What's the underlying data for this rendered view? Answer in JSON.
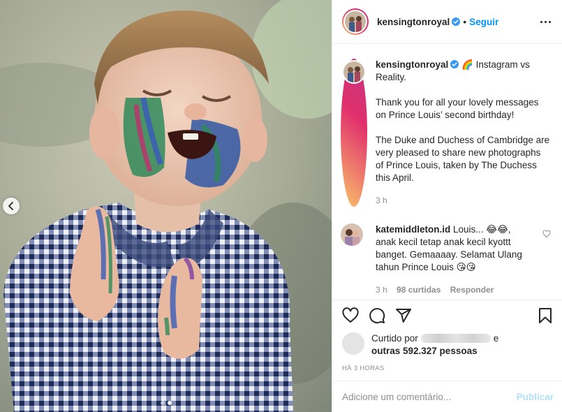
{
  "post": {
    "photo_alt": "Prince Louis with paint on his face and hands",
    "nav_prev_icon": "chevron-left-icon",
    "carousel_count": 2,
    "carousel_active": 1
  },
  "header": {
    "username": "kensingtonroyal",
    "verified_icon": "verified-badge-icon",
    "separator": "•",
    "follow_label": "Seguir",
    "more_icon": "more-options-icon"
  },
  "caption": {
    "username": "kensingtonroyal",
    "emoji": "🌈",
    "lines": [
      "Instagram vs Reality.",
      "Thank you for all your lovely messages on Prince Louis’ second birthday!",
      "The Duke and Duchess of Cambridge are very pleased to share new photographs of Prince Louis, taken by The Duchess this April."
    ],
    "time": "3 h"
  },
  "comments": [
    {
      "username": "katemiddleton.id",
      "text": "Louis... 😂😂, anak kecil tetap anak kecil kyottt banget. Gemaaaay. Selamat Ulang tahun Prince Louis 😘😘",
      "time": "3 h",
      "likes": "98 curtidas",
      "reply_label": "Responder"
    }
  ],
  "actions": {
    "like_icon": "heart-icon",
    "comment_icon": "comment-icon",
    "share_icon": "share-icon",
    "save_icon": "bookmark-icon"
  },
  "likes": {
    "prefix": "Curtido por",
    "suffix": "e",
    "others": "outras 592.327 pessoas"
  },
  "timestamp": "HÁ 3 HORAS",
  "add_comment": {
    "placeholder": "Adicione um comentário...",
    "publish_label": "Publicar"
  },
  "colors": {
    "link_blue": "#0095f6",
    "publish_disabled": "#b2dffc",
    "muted": "#8e8e8e",
    "text": "#262626"
  }
}
